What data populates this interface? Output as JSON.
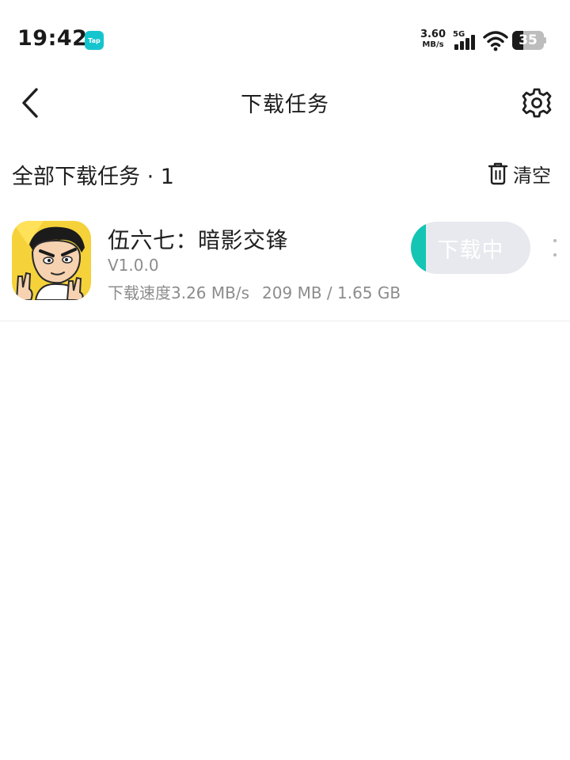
{
  "status_bar": {
    "time": "19:42",
    "app_badge": "Tap",
    "net_speed_value": "3.60",
    "net_speed_unit": "MB/s",
    "network_type": "5G",
    "battery_level": "35",
    "battery_fraction": 0.35,
    "icons": [
      "tap-icon",
      "signal-icon",
      "wifi-icon",
      "battery-icon"
    ]
  },
  "header": {
    "title": "下载任务",
    "back_icon": "chevron-left-icon",
    "settings_icon": "gear-icon"
  },
  "section": {
    "title": "全部下载任务 · 1",
    "clear_label": "清空",
    "clear_icon": "trash-icon"
  },
  "tasks": [
    {
      "name": "伍六七：暗影交锋",
      "version": "V1.0.0",
      "speed_label": "下载速度3.26 MB/s",
      "size_label": "209 MB / 1.65 GB",
      "progress_fraction": 0.124,
      "button_label": "下载中",
      "icon": "game-app-icon",
      "more_icon": "more-vertical-icon"
    }
  ],
  "colors": {
    "accent": "#15c5b4",
    "button_bg": "#e7e9ee",
    "secondary_text": "#8c8c8c",
    "tap_brand": "#15c5ce"
  }
}
